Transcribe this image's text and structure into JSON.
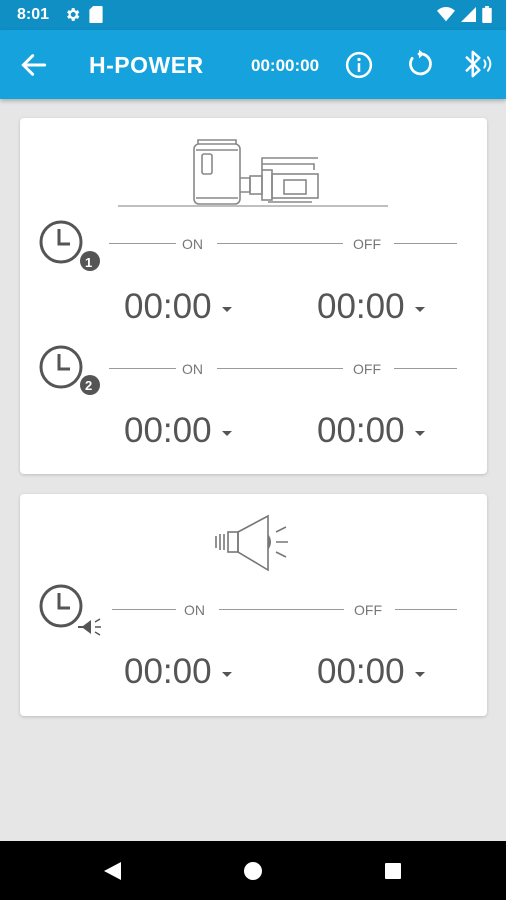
{
  "status_bar": {
    "time": "8:01",
    "icons": [
      "gear-icon",
      "sd-card-icon",
      "wifi-icon",
      "signal-icon",
      "battery-icon"
    ]
  },
  "app_bar": {
    "title": "H-POWER",
    "timer": "00:00:00",
    "icons": [
      "back-arrow-icon",
      "info-icon",
      "refresh-icon",
      "bluetooth-icon"
    ]
  },
  "pump_card": {
    "icon": "pump-icon",
    "timers": [
      {
        "badge": "1",
        "on_label": "ON",
        "off_label": "OFF",
        "on_time": "00:00",
        "off_time": "00:00"
      },
      {
        "badge": "2",
        "on_label": "ON",
        "off_label": "OFF",
        "on_time": "00:00",
        "off_time": "00:00"
      }
    ]
  },
  "speaker_card": {
    "icon": "speaker-icon",
    "timer": {
      "on_label": "ON",
      "off_label": "OFF",
      "on_time": "00:00",
      "off_time": "00:00"
    }
  },
  "colors": {
    "status_bar": "#0f8fc4",
    "app_bar": "#16a3dd",
    "background": "#e6e6e6",
    "card": "#ffffff"
  },
  "nav_bar": {
    "icons": [
      "back-triangle-icon",
      "home-circle-icon",
      "recents-square-icon"
    ]
  }
}
